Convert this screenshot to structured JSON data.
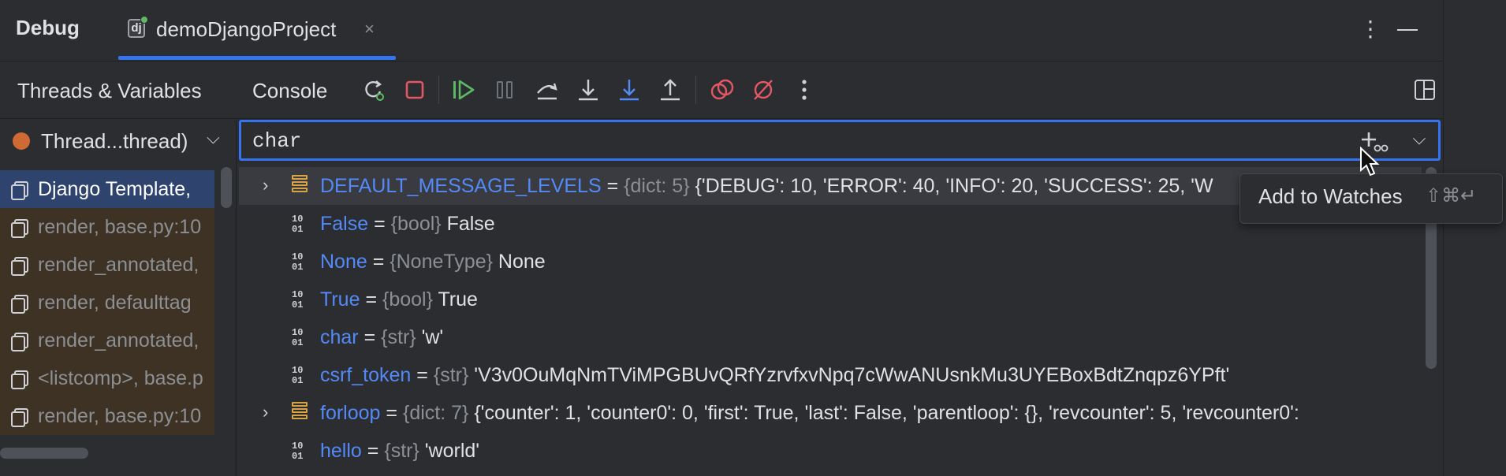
{
  "window": {
    "title": "Debug",
    "tab_label": "demoDjangoProject",
    "tab_close": "×",
    "more": "⋮"
  },
  "toolbar": {
    "tab_threads": "Threads & Variables",
    "tab_console": "Console",
    "icons": [
      "rerun-icon",
      "stop-icon",
      "resume-icon",
      "pause-icon",
      "step-over-icon",
      "step-into-icon",
      "step-into-my-code-icon",
      "step-out-icon",
      "view-breakpoints-icon",
      "mute-breakpoints-icon",
      "more-icon",
      "layout-icon"
    ]
  },
  "threads": {
    "selector_label": "Thread...thread)",
    "frames": [
      {
        "label": "Django Template,",
        "kind": "user"
      },
      {
        "label": "render, base.py:10",
        "kind": "library"
      },
      {
        "label": "render_annotated,",
        "kind": "library"
      },
      {
        "label": "render, defaulttag",
        "kind": "library"
      },
      {
        "label": "render_annotated,",
        "kind": "library"
      },
      {
        "label": "<listcomp>, base.p",
        "kind": "library"
      },
      {
        "label": "render, base.py:10",
        "kind": "library"
      }
    ]
  },
  "search": {
    "value": "char"
  },
  "variables": [
    {
      "expandable": true,
      "icon": "dict",
      "name": "DEFAULT_MESSAGE_LEVELS",
      "type": "{dict: 5}",
      "value": "{'DEBUG': 10, 'ERROR': 40, 'INFO': 20, 'SUCCESS': 25, 'W",
      "highlighted": true
    },
    {
      "expandable": false,
      "icon": "binary",
      "name": "False",
      "type": "{bool}",
      "value": "False"
    },
    {
      "expandable": false,
      "icon": "binary",
      "name": "None",
      "type": "{NoneType}",
      "value": "None"
    },
    {
      "expandable": false,
      "icon": "binary",
      "name": "True",
      "type": "{bool}",
      "value": "True"
    },
    {
      "expandable": false,
      "icon": "binary",
      "name": "char",
      "type": "{str}",
      "value": "'w'"
    },
    {
      "expandable": false,
      "icon": "binary",
      "name": "csrf_token",
      "type": "{str}",
      "value": "'V3v0OuMqNmTViMPGBUvQRfYzrvfxvNpq7cWwANUsnkMu3UYEBoxBdtZnqpz6YPft'"
    },
    {
      "expandable": true,
      "icon": "dict",
      "name": "forloop",
      "type": "{dict: 7}",
      "value": "{'counter': 1, 'counter0': 0, 'first': True, 'last': False, 'parentloop': {}, 'revcounter': 5, 'revcounter0':"
    },
    {
      "expandable": false,
      "icon": "binary",
      "name": "hello",
      "type": "{str}",
      "value": "'world'"
    }
  ],
  "tooltip": {
    "label": "Add to Watches",
    "shortcut": "⇧⌘↵"
  },
  "colors": {
    "accent": "#3574f0",
    "var_name": "#548af7",
    "thread_dot": "#d06a34",
    "library_frame_bg": "#3d3223",
    "selected_frame_bg": "#2e436e"
  }
}
